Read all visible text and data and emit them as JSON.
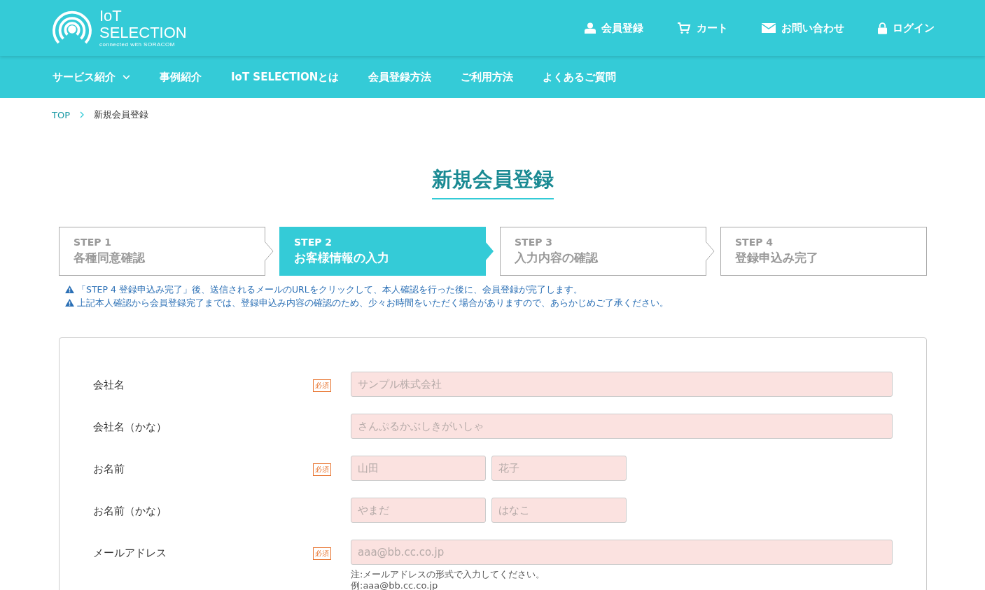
{
  "logo": {
    "line1": "IoT",
    "line2": "SELECTION",
    "tagline": "connected with SORACOM"
  },
  "header_links": [
    {
      "kind": "user",
      "label": "会員登録"
    },
    {
      "kind": "cart",
      "label": "カート"
    },
    {
      "kind": "mail",
      "label": "お問い合わせ"
    },
    {
      "kind": "lock",
      "label": "ログイン"
    }
  ],
  "nav": [
    {
      "label": "サービス紹介",
      "dropdown": true
    },
    {
      "label": "事例紹介",
      "dropdown": false
    },
    {
      "label": "IoT SELECTIONとは",
      "dropdown": false
    },
    {
      "label": "会員登録方法",
      "dropdown": false
    },
    {
      "label": "ご利用方法",
      "dropdown": false
    },
    {
      "label": "よくあるご質問",
      "dropdown": false
    }
  ],
  "breadcrumb": [
    "TOP",
    "新規会員登録"
  ],
  "title": "新規会員登録",
  "steps": [
    {
      "step": "STEP 1",
      "label": "各種同意確認",
      "selected": false
    },
    {
      "step": "STEP 2",
      "label": "お客様情報の入力",
      "selected": true
    },
    {
      "step": "STEP 3",
      "label": "入力内容の確認",
      "selected": false
    },
    {
      "step": "STEP 4",
      "label": "登録申込み完了",
      "selected": false
    }
  ],
  "notices": [
    "「STEP 4 登録申込み完了」後、送信されるメールのURLをクリックして、本人確認を行った後に、会員登録が完了します。",
    "上記本人確認から会員登録完了までは、登録申込み内容の確認のため、少々お時間をいただく場合がありますので、あらかじめご了承ください。"
  ],
  "form": [
    {
      "label": "会社名",
      "badge": "必須",
      "inputs": [
        {
          "placeholder": "サンプル株式会社"
        }
      ]
    },
    {
      "label": "会社名（かな）",
      "inputs": [
        {
          "placeholder": "さんぷるかぶしきがいしゃ"
        }
      ]
    },
    {
      "label": "お名前",
      "badge": "必須",
      "inputs": [
        {
          "placeholder": "山田"
        },
        {
          "placeholder": "花子"
        }
      ]
    },
    {
      "label": "お名前（かな）",
      "inputs": [
        {
          "placeholder": "やまだ"
        },
        {
          "placeholder": "はなこ"
        }
      ]
    },
    {
      "label": "メールアドレス",
      "badge": "必須",
      "inputs": [
        {
          "placeholder": "aaa@bb.cc.co.jp"
        }
      ],
      "notes": [
        "注:メールアドレスの形式で入力してください。",
        "例:aaa@bb.cc.co.jp"
      ]
    }
  ]
}
